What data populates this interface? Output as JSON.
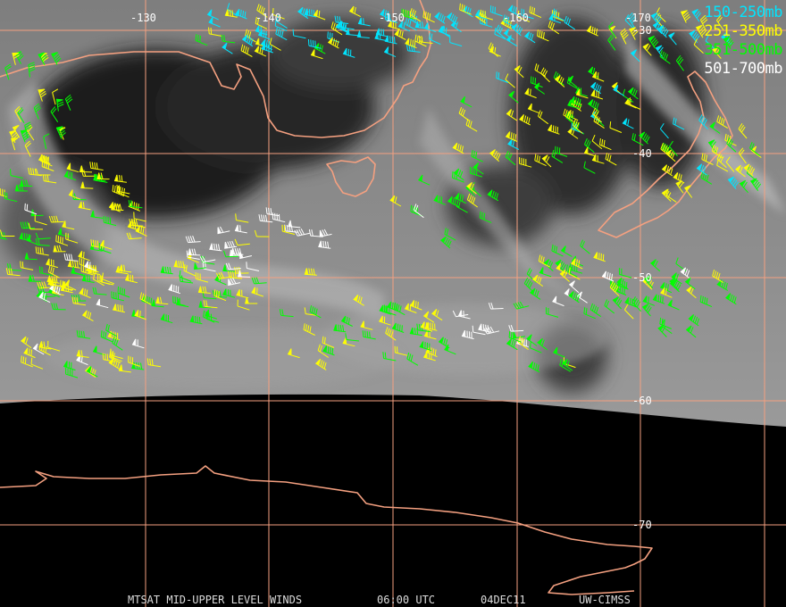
{
  "legend": [
    {
      "label": "150-250mb",
      "color": "#00e5ff"
    },
    {
      "label": "251-350mb",
      "color": "#ffff00"
    },
    {
      "label": "351-500mb",
      "color": "#00ff00"
    },
    {
      "label": "501-700mb",
      "color": "#ffffff"
    }
  ],
  "longitude_labels": [
    "-130",
    "-140",
    "-150",
    "-160",
    "-170"
  ],
  "latitude_labels": [
    "-30",
    "-40",
    "-50",
    "-60",
    "-70"
  ],
  "footer": {
    "product": "MTSAT MID-UPPER LEVEL WINDS",
    "time": "06:00 UTC",
    "date": "04DEC11",
    "source": "UW-CIMSS"
  },
  "colors": {
    "grid": "#f4a080",
    "coast": "#f4a080",
    "imagery": "#8a8a8a",
    "space": "#000000"
  }
}
